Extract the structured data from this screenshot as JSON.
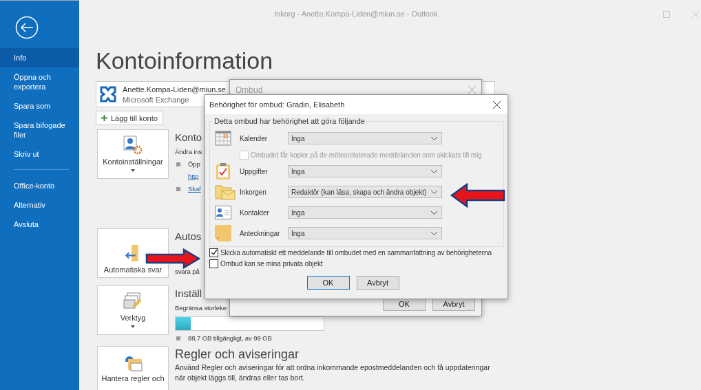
{
  "window": {
    "title": "Inkorg - Anette.Kompa-Liden@miun.se  -  Outlook"
  },
  "sidebar": {
    "groups": [
      [
        {
          "label": "Info",
          "selected": true
        },
        {
          "label": "Öppna och exportera",
          "selected": false
        },
        {
          "label": "Spara som",
          "selected": false
        },
        {
          "label": "Spara bifogade filer",
          "selected": false
        },
        {
          "label": "Skriv ut",
          "selected": false
        }
      ],
      [
        {
          "label": "Office-konto",
          "selected": false
        },
        {
          "label": "Alternativ",
          "selected": false
        },
        {
          "label": "Avsluta",
          "selected": false
        }
      ]
    ]
  },
  "page": {
    "heading": "Kontoinformation"
  },
  "account": {
    "email": "Anette.Kompa-Liden@miun.se",
    "type": "Microsoft Exchange"
  },
  "add_account_button": "Lägg till konto",
  "sections": [
    {
      "kind": "account-settings",
      "tile_label": "Kontoinställningar",
      "dropdown": true,
      "heading": "Konto",
      "lines": [
        {
          "kind": "text",
          "text": "Ändra ins"
        },
        {
          "kind": "bullet",
          "text": "Öpp"
        },
        {
          "kind": "link",
          "text": "http"
        },
        {
          "kind": "bullet-link",
          "text": "Skaf"
        }
      ]
    },
    {
      "kind": "auto-reply",
      "tile_label": "Automatiska svar",
      "dropdown": false,
      "heading": "Autos",
      "lines": [
        {
          "kind": "gap"
        },
        {
          "kind": "text",
          "text": "svara på"
        }
      ]
    },
    {
      "kind": "tools",
      "tile_label": "Verktyg",
      "dropdown": true,
      "heading": "Inställ",
      "lines": [
        {
          "kind": "text",
          "text": "Begränsa storleke"
        },
        {
          "kind": "meter",
          "level": 0.1
        },
        {
          "kind": "bullet",
          "text": "88,7 GB tillgängligt, av 99 GB"
        }
      ]
    },
    {
      "kind": "rules",
      "tile_label": "Hantera regler och",
      "dropdown": false,
      "heading": "Regler och aviseringar",
      "lines": [
        {
          "kind": "wide-text",
          "text": "Använd Regler och aviseringar för att ordna inkommande epostmeddelanden och få uppdateringar när objekt läggs till, ändras eller tas bort."
        }
      ]
    }
  ],
  "delegates_dialog": {
    "title": "Ombud",
    "buttons": [
      "OK",
      "Avbryt"
    ]
  },
  "permissions_dialog": {
    "title": "Behörighet för ombud: Gradin, Elisabeth",
    "group_label": "Detta ombud har behörighet att göra följande",
    "rows": [
      {
        "kind": "calendar",
        "label": "Kalender",
        "value": "Inga"
      },
      {
        "kind": "option",
        "label": "Ombudet får kopior på de mötesrelaterade meddelanden som skickats till mig",
        "checked": false,
        "disabled": true
      },
      {
        "kind": "tasks",
        "label": "Uppgifter",
        "value": "Inga"
      },
      {
        "kind": "inbox",
        "label": "Inkorgen",
        "value": "Redaktör (kan läsa, skapa och ändra objekt)"
      },
      {
        "kind": "contacts",
        "label": "Kontakter",
        "value": "Inga"
      },
      {
        "kind": "notes",
        "label": "Anteckningar",
        "value": "Inga"
      }
    ],
    "options": [
      {
        "label": "Skicka automatiskt ett meddelande till ombudet med en sammanfattning av behörigheterna",
        "checked": true,
        "disabled": false
      },
      {
        "label": "Ombud kan se mina privata objekt",
        "checked": false,
        "disabled": false
      }
    ],
    "buttons": [
      {
        "label": "OK",
        "focused": true
      },
      {
        "label": "Avbryt",
        "focused": false
      }
    ]
  }
}
